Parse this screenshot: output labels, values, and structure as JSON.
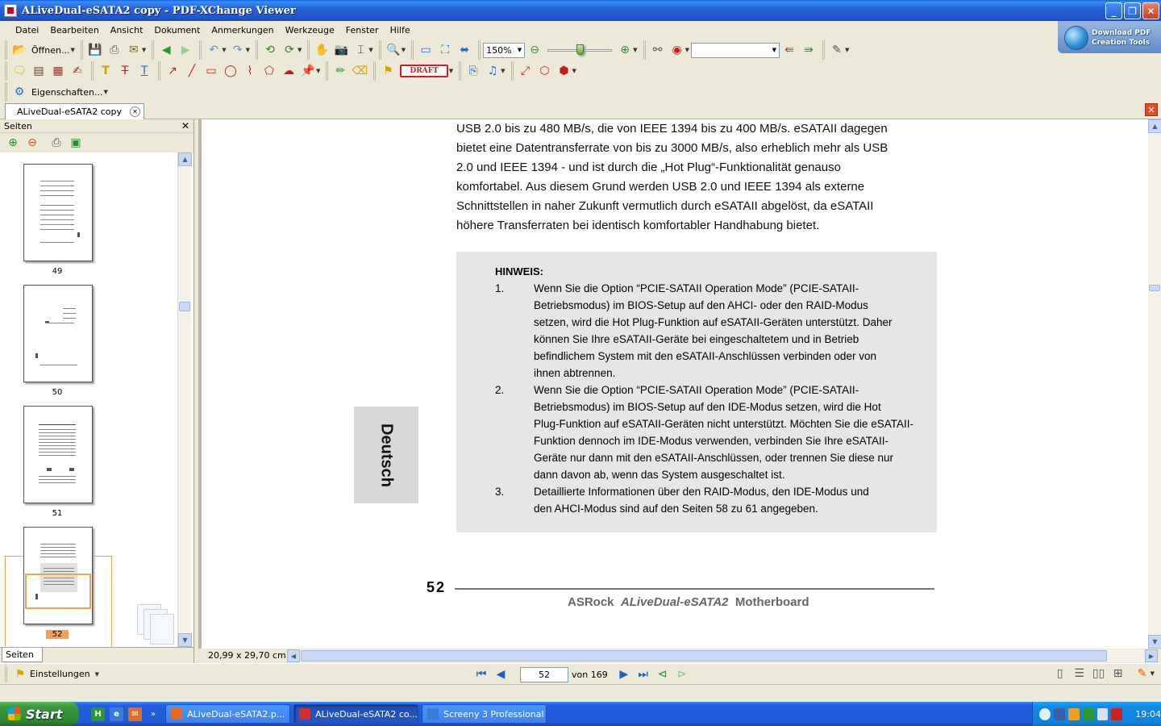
{
  "window": {
    "title": "ALiveDual-eSATA2 copy - PDF-XChange Viewer",
    "minimize": "_",
    "restore": "❐",
    "close": "✕"
  },
  "menu": [
    "Datei",
    "Bearbeiten",
    "Ansicht",
    "Dokument",
    "Anmerkungen",
    "Werkzeuge",
    "Fenster",
    "Hilfe"
  ],
  "promo": {
    "line1": "Download PDF",
    "line2": "Creation Tools"
  },
  "toolbar": {
    "open_label": "Öffnen...",
    "zoom_value": "150%",
    "draft_label": "DRAFT",
    "properties_label": "Eigenschaften..."
  },
  "tabs": {
    "doc_tab_label": "ALiveDual-eSATA2 copy",
    "tab_close": "✕",
    "close_doc": "✕"
  },
  "sidebar": {
    "title": "Seiten",
    "close": "✕",
    "footer_tab": "Seiten",
    "thumbnails": [
      {
        "label": "49"
      },
      {
        "label": "50"
      },
      {
        "label": "51"
      },
      {
        "label": "52",
        "selected": true
      }
    ]
  },
  "document": {
    "paragraph_lines": [
      "USB 2.0 bis zu 480 MB/s, die von IEEE 1394 bis zu 400 MB/s. eSATAII dagegen",
      "bietet eine Datentransferrate von bis zu 3000 MB/s, also erheblich mehr als USB",
      "2.0 und IEEE 1394 - und ist durch die „Hot Plug“-Funktionalität genauso",
      "komfortabel. Aus diesem Grund werden USB 2.0 und IEEE 1394 als externe",
      "Schnittstellen in naher Zukunft vermutlich durch eSATAII abgelöst, da eSATAII",
      "höhere Transferraten bei identisch komfortabler Handhabung bietet."
    ],
    "note_title": "HINWEIS:",
    "notes": [
      {
        "num": "1.",
        "lines": [
          "Wenn Sie die Option “PCIE-SATAII Operation Mode” (PCIE-SATAII-",
          "Betriebsmodus) im BIOS-Setup auf den AHCI- oder den RAID-Modus",
          "setzen, wird die Hot Plug-Funktion auf eSATAII-Geräten unterstützt. Daher",
          "können Sie Ihre eSATAII-Geräte bei eingeschaltetem und in Betrieb",
          "befindlichem System mit den eSATAII-Anschlüssen verbinden oder von",
          "ihnen abtrennen."
        ]
      },
      {
        "num": "2.",
        "lines": [
          "Wenn Sie die Option “PCIE-SATAII Operation Mode” (PCIE-SATAII-",
          "Betriebsmodus) im BIOS-Setup auf den IDE-Modus setzen, wird die Hot",
          "Plug-Funktion auf eSATAII-Geräten nicht unterstützt. Möchten Sie die eSATAII-",
          "Funktion dennoch im IDE-Modus verwenden, verbinden Sie Ihre eSATAII-",
          "Geräte nur dann mit den eSATAII-Anschlüssen, oder trennen Sie diese nur",
          "dann davon ab, wenn das System ausgeschaltet ist."
        ]
      },
      {
        "num": "3.",
        "lines": [
          "Detaillierte Informationen über den RAID-Modus, den IDE-Modus und",
          "den AHCI-Modus sind auf den Seiten 58 zu 61 angegeben."
        ]
      }
    ],
    "language_tab": "Deutsch",
    "page_number": "52",
    "footer_brand_a": "ASRock",
    "footer_brand_b": "ALiveDual-eSATA2",
    "footer_brand_c": "Motherboard"
  },
  "info": {
    "page_size": "20,99 x 29,70 cm"
  },
  "nav": {
    "settings_label": "Einstellungen",
    "current_page": "52",
    "total_label": "von 169"
  },
  "taskbar": {
    "start_label": "Start",
    "tasks": [
      {
        "label": "ALiveDual-eSATA2.p...",
        "color": "#e86a1a",
        "active": false
      },
      {
        "label": "ALiveDual-eSATA2 co...",
        "color": "#d23030",
        "active": true
      },
      {
        "label": "Screeny 3 Professional",
        "color": "#3a7ad6",
        "active": false
      }
    ],
    "clock": "19:04"
  },
  "colors": {
    "accent": "#f5a050",
    "titlebar": "#2563d8",
    "note_bg": "#e6e6e6"
  }
}
